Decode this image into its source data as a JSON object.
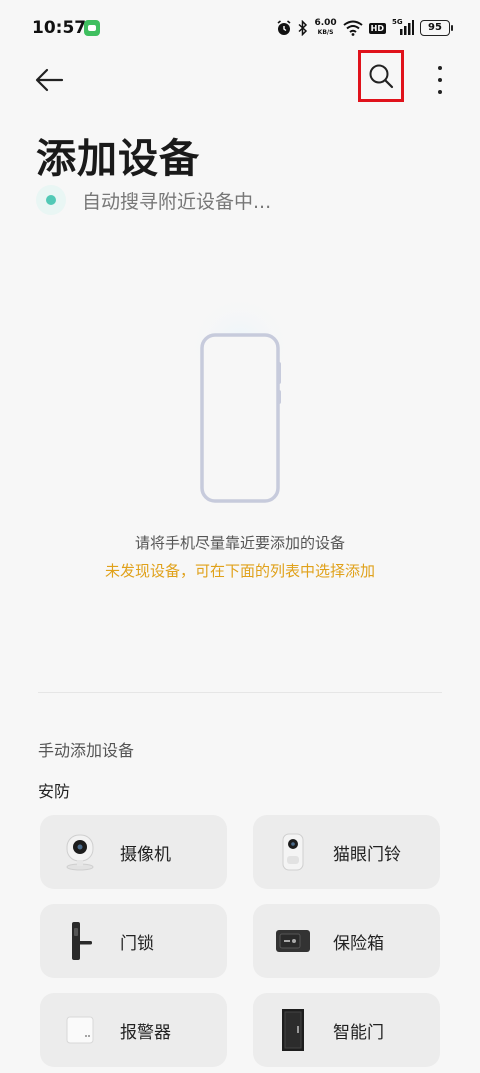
{
  "status_bar": {
    "time": "10:57",
    "net_speed": "6.00",
    "net_unit": "KB/S",
    "hd_badge": "HD",
    "signal_label": "5G",
    "battery": "95"
  },
  "header": {
    "title": "添加设备"
  },
  "scan": {
    "status_text": "自动搜寻附近设备中..."
  },
  "hints": {
    "primary": "请将手机尽量靠近要添加的设备",
    "secondary": "未发现设备，可在下面的列表中选择添加"
  },
  "manual": {
    "section_title": "手动添加设备",
    "category": "安防",
    "devices": [
      {
        "label": "摄像机",
        "icon": "camera-icon"
      },
      {
        "label": "猫眼门铃",
        "icon": "doorbell-icon"
      },
      {
        "label": "门锁",
        "icon": "door-lock-icon"
      },
      {
        "label": "保险箱",
        "icon": "safe-icon"
      },
      {
        "label": "报警器",
        "icon": "alarm-icon"
      },
      {
        "label": "智能门",
        "icon": "smart-door-icon"
      }
    ]
  },
  "colors": {
    "accent_highlight": "#e0121b",
    "hint_warning": "#e0a11a",
    "scan_dot": "#52c9b6"
  }
}
